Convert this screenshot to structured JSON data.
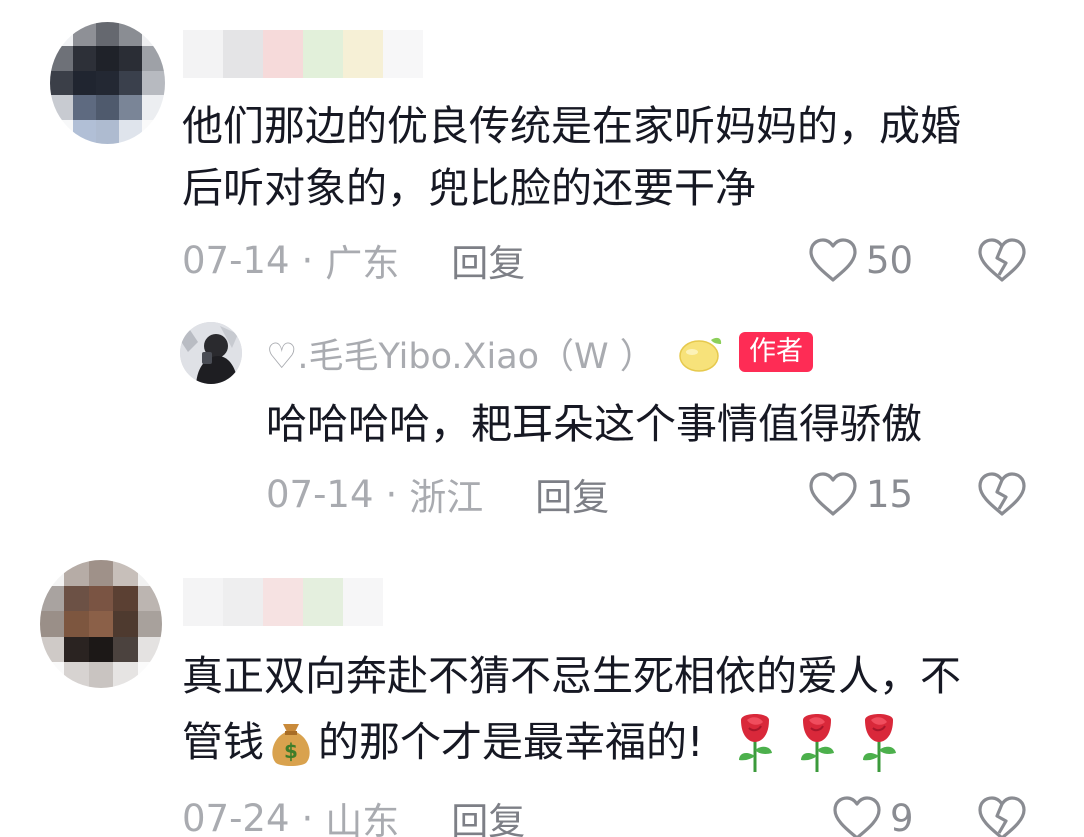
{
  "colors": {
    "text": "#161823",
    "meta": "#a9abb0",
    "reply": "#7d7f86",
    "like_icon": "#8a8c92",
    "author_badge_bg": "#fe2c55"
  },
  "comments": [
    {
      "text_line1": "他们那边的优良传统是在家听妈妈的，成婚",
      "text_line2": "后听对象的，兜比脸的还要干净",
      "date": "07-14",
      "separator": "·",
      "location": "广东",
      "reply_label": "回复",
      "likes": "50",
      "reply": {
        "username": "♡.毛毛Yibo.Xiao（W ）",
        "author_badge": "作者",
        "text": "哈哈哈哈，耙耳朵这个事情值得骄傲",
        "date": "07-14",
        "separator": "·",
        "location": "浙江",
        "reply_label": "回复",
        "likes": "15"
      }
    },
    {
      "text_line1": "真正双向奔赴不猜不忌生死相依的爱人，不",
      "text_line2_a": "管钱",
      "text_line2_b": "的那个才是最幸福的!",
      "emojis": [
        "money-bag-icon",
        "rose-icon",
        "rose-icon",
        "rose-icon"
      ],
      "date": "07-24",
      "separator": "·",
      "location": "山东",
      "reply_label": "回复",
      "likes": "9"
    }
  ]
}
